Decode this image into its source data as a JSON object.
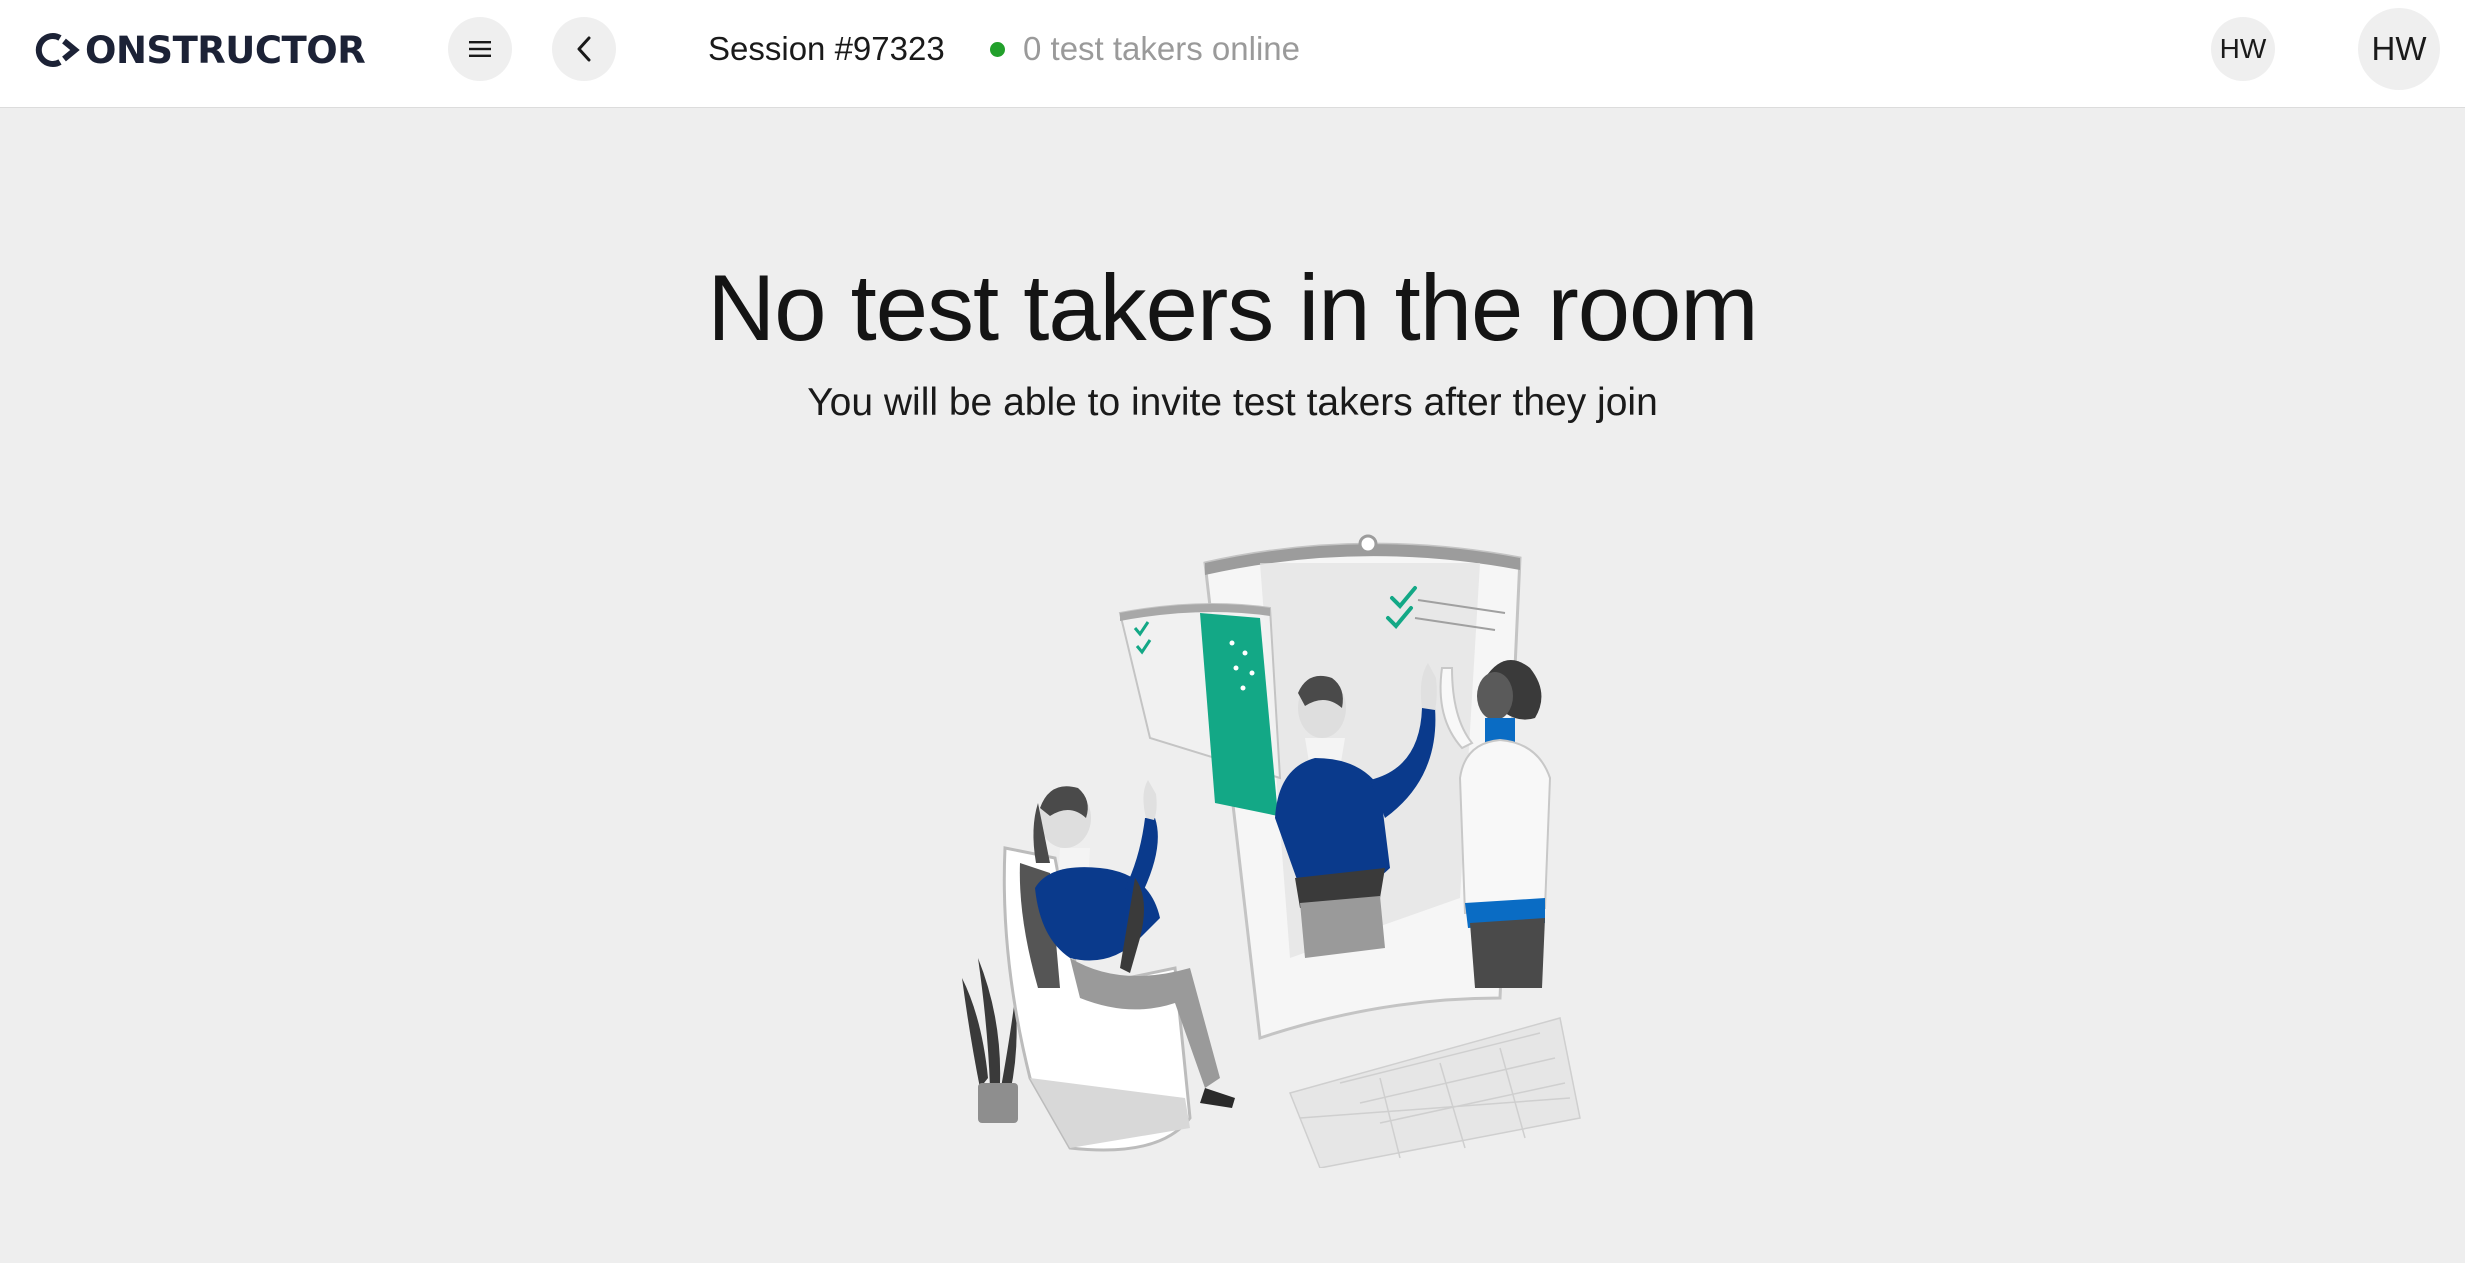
{
  "header": {
    "logo_text": "ONSTRUCTOR",
    "logo_icon": "constructor-logo-icon",
    "menu_icon": "hamburger-menu-icon",
    "back_icon": "chevron-left-icon",
    "session_title": "Session #97323",
    "status": {
      "text": "0 test takers online",
      "dot_color": "#22a02b"
    },
    "avatar_small": "HW",
    "avatar_large": "HW"
  },
  "empty_state": {
    "title": "No test takers in the room",
    "subtitle": "You will be able to invite test takers after they join",
    "illustration": "proctoring-room-illustration"
  },
  "colors": {
    "accent_blue": "#0a3a8c",
    "accent_teal": "#13a886",
    "background": "#eeeeee"
  }
}
